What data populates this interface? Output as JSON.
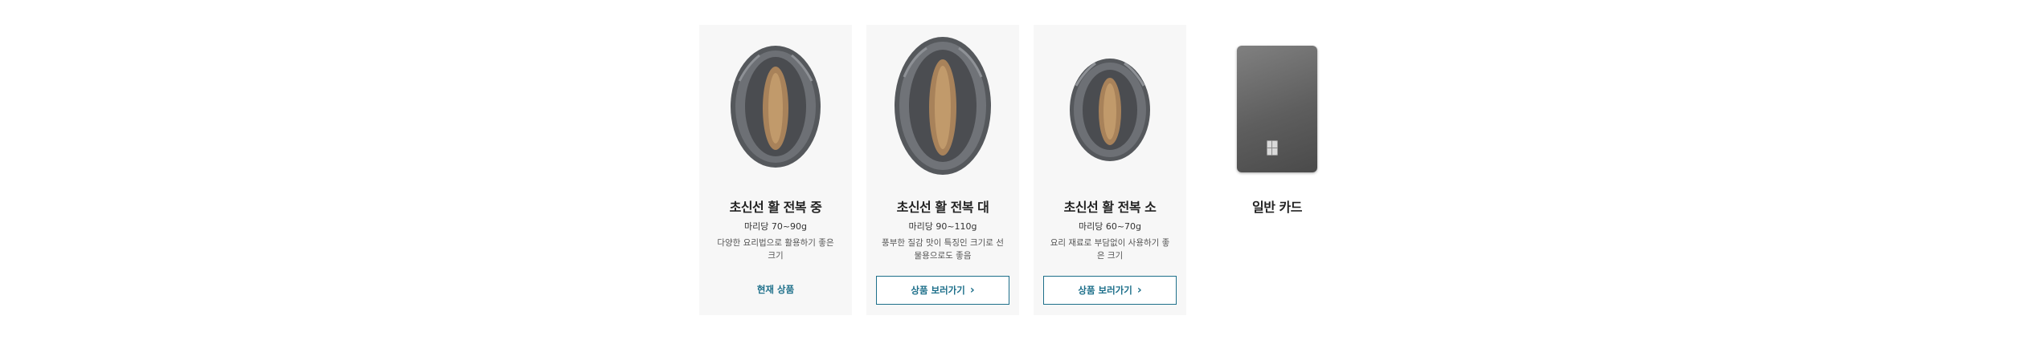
{
  "products": [
    {
      "name": "초신선 활 전복 중",
      "weight": "마리당 70~90g",
      "desc": "다양한 요리법으로 활용하기 좋은 크기",
      "status": "현재 상품",
      "image": "abalone-medium"
    },
    {
      "name": "초신선 활 전복 대",
      "weight": "마리당 90~110g",
      "desc": "풍부한 질감 맛이 특징인 크기로 선물용으로도 좋음",
      "button": "상품 보러가기",
      "image": "abalone-large"
    },
    {
      "name": "초신선 활 전복 소",
      "weight": "마리당 60~70g",
      "desc": "요리 재료로 부담없이 사용하기 좋은 크기",
      "button": "상품 보러가기",
      "image": "abalone-small"
    }
  ],
  "payment_card": {
    "name": "일반 카드",
    "image": "card-icon"
  },
  "colors": {
    "accent": "#1d6f8a",
    "card_bg": "#f7f7f7"
  }
}
